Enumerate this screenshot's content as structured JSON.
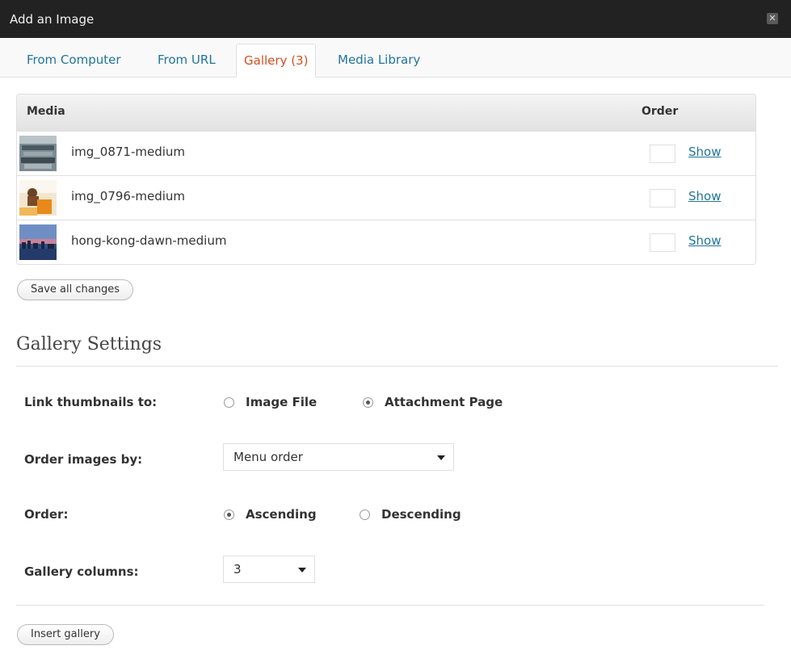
{
  "dialog": {
    "title": "Add an Image",
    "close_icon": "close-icon"
  },
  "tabs": [
    {
      "label": "From Computer"
    },
    {
      "label": "From URL"
    },
    {
      "label": "Gallery (3)"
    },
    {
      "label": "Media Library"
    }
  ],
  "active_tab": "Gallery (3)",
  "media_table": {
    "headers": {
      "media": "Media",
      "order": "Order"
    },
    "rows": [
      {
        "name": "img_0871-medium",
        "order": "",
        "action": "Show"
      },
      {
        "name": "img_0796-medium",
        "order": "",
        "action": "Show"
      },
      {
        "name": "hong-kong-dawn-medium",
        "order": "",
        "action": "Show"
      }
    ]
  },
  "save_button": "Save all changes",
  "gallery_settings": {
    "title": "Gallery Settings",
    "link_thumbnails": {
      "label": "Link thumbnails to:",
      "options": [
        "Image File",
        "Attachment Page"
      ],
      "selected": "Attachment Page"
    },
    "order_by": {
      "label": "Order images by:",
      "value": "Menu order"
    },
    "order": {
      "label": "Order:",
      "options": [
        "Ascending",
        "Descending"
      ],
      "selected": "Ascending"
    },
    "columns": {
      "label": "Gallery columns:",
      "value": "3"
    }
  },
  "insert_button": "Insert gallery",
  "colors": {
    "link": "#21759b",
    "active_tab": "#d54e21",
    "titlebar": "#222222"
  }
}
